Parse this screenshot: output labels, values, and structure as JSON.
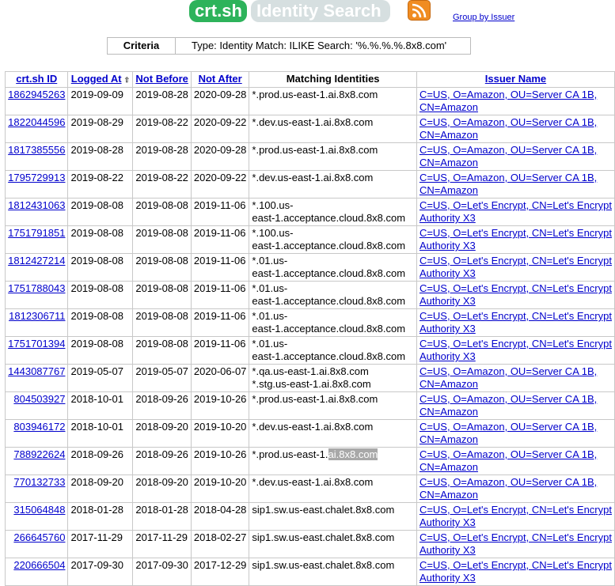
{
  "header": {
    "logo_crt": "crt.sh",
    "logo_search": "Identity Search",
    "rss_icon": "rss-feed-icon",
    "group_link": "Group by Issuer"
  },
  "criteria": {
    "label": "Criteria",
    "text": "Type: Identity   Match: ILIKE   Search: '%.%.%.%.8x8.com'"
  },
  "table": {
    "headers": [
      "crt.sh ID",
      "Logged At",
      "Not Before",
      "Not After",
      "Matching Identities",
      "Issuer Name"
    ],
    "sort_icon": "⇧",
    "rows": [
      {
        "id": "1862945263",
        "logged": "2019-09-09",
        "before": "2019-08-28",
        "after": "2020-09-28",
        "ident": [
          "*.prod.us-east-1.ai.8x8.com"
        ],
        "issuer": [
          "C=US, O=Amazon, OU=Server CA 1B,",
          "CN=Amazon"
        ]
      },
      {
        "id": "1822044596",
        "logged": "2019-08-29",
        "before": "2019-08-22",
        "after": "2020-09-22",
        "ident": [
          "*.dev.us-east-1.ai.8x8.com"
        ],
        "issuer": [
          "C=US, O=Amazon, OU=Server CA 1B,",
          "CN=Amazon"
        ]
      },
      {
        "id": "1817385556",
        "logged": "2019-08-28",
        "before": "2019-08-28",
        "after": "2020-09-28",
        "ident": [
          "*.prod.us-east-1.ai.8x8.com"
        ],
        "issuer": [
          "C=US, O=Amazon, OU=Server CA 1B,",
          "CN=Amazon"
        ]
      },
      {
        "id": "1795729913",
        "logged": "2019-08-22",
        "before": "2019-08-22",
        "after": "2020-09-22",
        "ident": [
          "*.dev.us-east-1.ai.8x8.com"
        ],
        "issuer": [
          "C=US, O=Amazon, OU=Server CA 1B,",
          "CN=Amazon"
        ]
      },
      {
        "id": "1812431063",
        "logged": "2019-08-08",
        "before": "2019-08-08",
        "after": "2019-11-06",
        "ident": [
          "*.100.us-",
          "east-1.acceptance.cloud.8x8.com"
        ],
        "issuer": [
          "C=US, O=Let's Encrypt, CN=Let's Encrypt",
          "Authority X3"
        ]
      },
      {
        "id": "1751791851",
        "logged": "2019-08-08",
        "before": "2019-08-08",
        "after": "2019-11-06",
        "ident": [
          "*.100.us-",
          "east-1.acceptance.cloud.8x8.com"
        ],
        "issuer": [
          "C=US, O=Let's Encrypt, CN=Let's Encrypt",
          "Authority X3"
        ]
      },
      {
        "id": "1812427214",
        "logged": "2019-08-08",
        "before": "2019-08-08",
        "after": "2019-11-06",
        "ident": [
          "*.01.us-",
          "east-1.acceptance.cloud.8x8.com"
        ],
        "issuer": [
          "C=US, O=Let's Encrypt, CN=Let's Encrypt",
          "Authority X3"
        ]
      },
      {
        "id": "1751788043",
        "logged": "2019-08-08",
        "before": "2019-08-08",
        "after": "2019-11-06",
        "ident": [
          "*.01.us-",
          "east-1.acceptance.cloud.8x8.com"
        ],
        "issuer": [
          "C=US, O=Let's Encrypt, CN=Let's Encrypt",
          "Authority X3"
        ]
      },
      {
        "id": "1812306711",
        "logged": "2019-08-08",
        "before": "2019-08-08",
        "after": "2019-11-06",
        "ident": [
          "*.01.us-",
          "east-1.acceptance.cloud.8x8.com"
        ],
        "issuer": [
          "C=US, O=Let's Encrypt, CN=Let's Encrypt",
          "Authority X3"
        ]
      },
      {
        "id": "1751701394",
        "logged": "2019-08-08",
        "before": "2019-08-08",
        "after": "2019-11-06",
        "ident": [
          "*.01.us-",
          "east-1.acceptance.cloud.8x8.com"
        ],
        "issuer": [
          "C=US, O=Let's Encrypt, CN=Let's Encrypt",
          "Authority X3"
        ]
      },
      {
        "id": "1443087767",
        "logged": "2019-05-07",
        "before": "2019-05-07",
        "after": "2020-06-07",
        "ident": [
          "*.qa.us-east-1.ai.8x8.com",
          "*.stg.us-east-1.ai.8x8.com"
        ],
        "issuer": [
          "C=US, O=Amazon, OU=Server CA 1B,",
          "CN=Amazon"
        ]
      },
      {
        "id": "804503927",
        "logged": "2018-10-01",
        "before": "2018-09-26",
        "after": "2019-10-26",
        "ident": [
          "*.prod.us-east-1.ai.8x8.com"
        ],
        "issuer": [
          "C=US, O=Amazon, OU=Server CA 1B,",
          "CN=Amazon"
        ]
      },
      {
        "id": "803946172",
        "logged": "2018-10-01",
        "before": "2018-09-20",
        "after": "2019-10-20",
        "ident": [
          "*.dev.us-east-1.ai.8x8.com"
        ],
        "issuer": [
          "C=US, O=Amazon, OU=Server CA 1B,",
          "CN=Amazon"
        ]
      },
      {
        "id": "788922624",
        "logged": "2018-09-26",
        "before": "2018-09-26",
        "after": "2019-10-26",
        "ident": [
          "*.prod.us-east-1.ai.8x8.com"
        ],
        "issuer": [
          "C=US, O=Amazon, OU=Server CA 1B,",
          "CN=Amazon"
        ],
        "highlight": "ai.8x8.com"
      },
      {
        "id": "770132733",
        "logged": "2018-09-20",
        "before": "2018-09-20",
        "after": "2019-10-20",
        "ident": [
          "*.dev.us-east-1.ai.8x8.com"
        ],
        "issuer": [
          "C=US, O=Amazon, OU=Server CA 1B,",
          "CN=Amazon"
        ]
      },
      {
        "id": "315064848",
        "logged": "2018-01-28",
        "before": "2018-01-28",
        "after": "2018-04-28",
        "ident": [
          "sip1.sw.us-east.chalet.8x8.com"
        ],
        "issuer": [
          "C=US, O=Let's Encrypt, CN=Let's Encrypt",
          "Authority X3"
        ]
      },
      {
        "id": "266645760",
        "logged": "2017-11-29",
        "before": "2017-11-29",
        "after": "2018-02-27",
        "ident": [
          "sip1.sw.us-east.chalet.8x8.com"
        ],
        "issuer": [
          "C=US, O=Let's Encrypt, CN=Let's Encrypt",
          "Authority X3"
        ]
      },
      {
        "id": "220666504",
        "logged": "2017-09-30",
        "before": "2017-09-30",
        "after": "2017-12-29",
        "ident": [
          "sip1.sw.us-east.chalet.8x8.com"
        ],
        "issuer": [
          "C=US, O=Let's Encrypt, CN=Let's Encrypt",
          "Authority X3"
        ]
      }
    ]
  }
}
